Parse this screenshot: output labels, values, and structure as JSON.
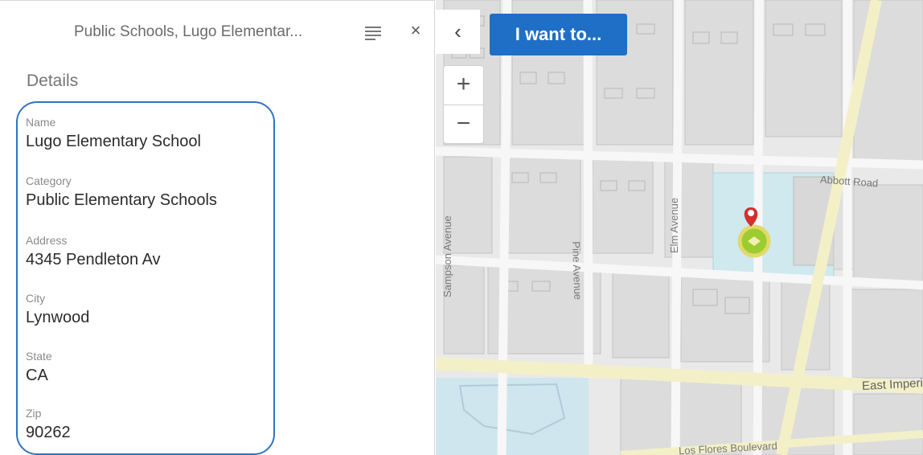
{
  "panel": {
    "title": "Public Schools, Lugo Elementar...",
    "section_title": "Details",
    "list_icon": "list-icon",
    "close_icon": "close-icon",
    "close_glyph": "×",
    "fields": [
      {
        "label": "Name",
        "value": "Lugo Elementary School"
      },
      {
        "label": "Category",
        "value": "Public Elementary Schools"
      },
      {
        "label": "Address",
        "value": "4345 Pendleton Av"
      },
      {
        "label": "City",
        "value": "Lynwood"
      },
      {
        "label": "State",
        "value": "CA"
      },
      {
        "label": "Zip",
        "value": "90262"
      }
    ]
  },
  "map": {
    "collapse_glyph": "‹",
    "i_want_to": "I want to...",
    "zoom_in": "+",
    "zoom_out": "−",
    "streets": {
      "abbott": "Abbott Road",
      "pine": "Pine Avenue",
      "elm": "Elm Avenue",
      "sampson": "Sampson Avenue",
      "east_imperial": "East Imperi",
      "los_flores": "Los Flores Boulevard"
    },
    "colors": {
      "accent": "#1f6fc6",
      "highlight_border": "#2f74c0",
      "pin": "#d32f2f",
      "marker": "#9ccc2f"
    }
  }
}
